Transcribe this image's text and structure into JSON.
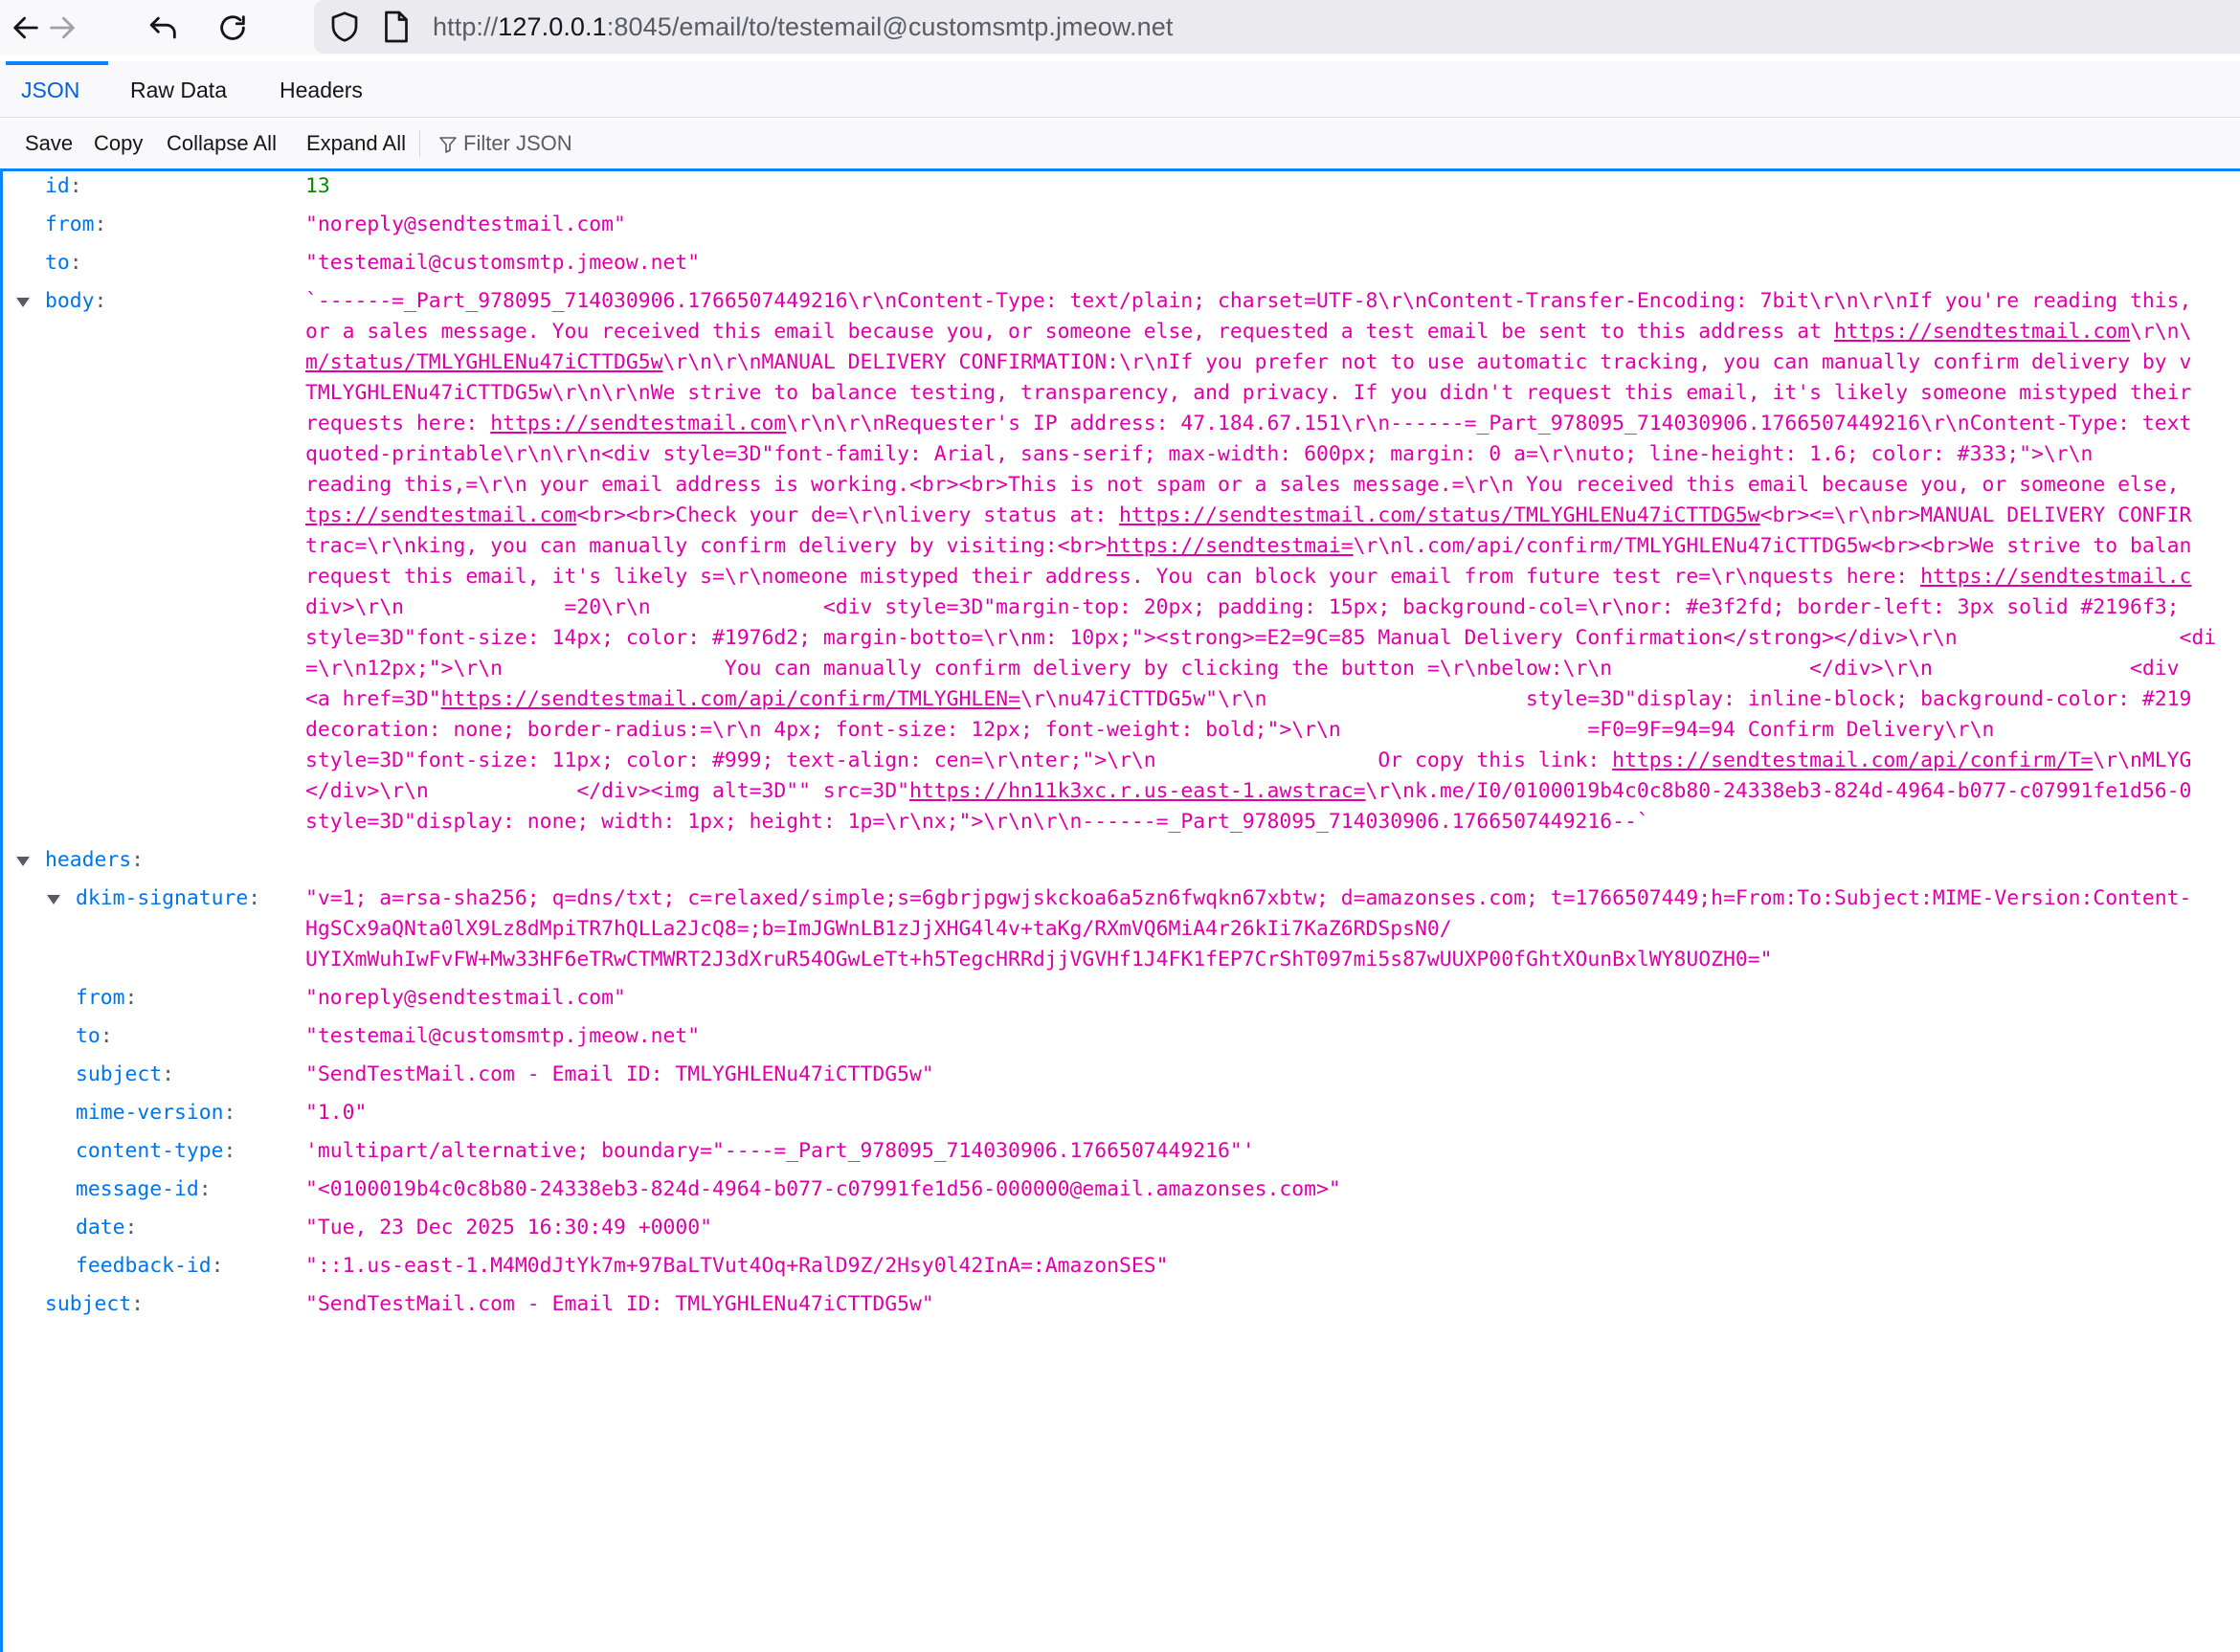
{
  "browser": {
    "url_prefix": "http://",
    "url_host": "127.0.0.1",
    "url_rest": ":8045/email/to/testemail@customsmtp.jmeow.net",
    "back_icon": "arrow-left",
    "forward_icon": "arrow-right",
    "undo_icon": "undo-arrow",
    "reload_icon": "reload"
  },
  "tabs": {
    "json": "JSON",
    "raw": "Raw Data",
    "headers": "Headers"
  },
  "toolbar": {
    "save": "Save",
    "copy": "Copy",
    "collapse": "Collapse All",
    "expand": "Expand All",
    "filter_placeholder": "Filter JSON"
  },
  "json": {
    "id_key": "id",
    "id": "13",
    "from_key": "from",
    "from": "\"noreply@sendtestmail.com\"",
    "to_key": "to",
    "to": "\"testemail@customsmtp.jmeow.net\"",
    "body_key": "body",
    "body_lines": [
      "`------=_Part_978095_714030906.1766507449216\\r\\nContent-Type: text/plain; charset=UTF-8\\r\\nContent-Transfer-Encoding: 7bit\\r\\n\\r\\nIf you're reading this,",
      "or a sales message. You received this email because you, or someone else, requested a test email be sent to this address at https://sendtestmail.com\\r\\n\\",
      "m/status/TMLYGHLENu47iCTTDG5w\\r\\n\\r\\nMANUAL DELIVERY CONFIRMATION:\\r\\nIf you prefer not to use automatic tracking, you can manually confirm delivery by v",
      "TMLYGHLENu47iCTTDG5w\\r\\n\\r\\nWe strive to balance testing, transparency, and privacy. If you didn't request this email, it's likely someone mistyped their",
      "requests here: https://sendtestmail.com\\r\\n\\r\\nRequester's IP address: 47.184.67.151\\r\\n------=_Part_978095_714030906.1766507449216\\r\\nContent-Type: text",
      "quoted-printable\\r\\n\\r\\n<div style=3D\"font-family: Arial, sans-serif; max-width: 600px; margin: 0 a=\\r\\nuto; line-height: 1.6; color: #333;\">\\r\\n",
      "reading this,=\\r\\n your email address is working.<br><br>This is not spam or a sales message.=\\r\\n You received this email because you, or someone else,",
      "tps://sendtestmail.com<br><br>Check your de=\\r\\nlivery status at: https://sendtestmail.com/status/TMLYGHLENu47iCTTDG5w<br><=\\r\\nbr>MANUAL DELIVERY CONFIR",
      "trac=\\r\\nking, you can manually confirm delivery by visiting:<br>https://sendtestmai=\\r\\nl.com/api/confirm/TMLYGHLENu47iCTTDG5w<br><br>We strive to balan",
      "request this email, it's likely s=\\r\\nomeone mistyped their address. You can block your email from future test re=\\r\\nquests here: https://sendtestmail.c",
      "div>\\r\\n             =20\\r\\n              <div style=3D\"margin-top: 20px; padding: 15px; background-col=\\r\\nor: #e3f2fd; border-left: 3px solid #2196f3;",
      "style=3D\"font-size: 14px; color: #1976d2; margin-botto=\\r\\nm: 10px;\"><strong>=E2=9C=85 Manual Delivery Confirmation</strong></div>\\r\\n                  <di",
      "=\\r\\n12px;\">\\r\\n                  You can manually confirm delivery by clicking the button =\\r\\nbelow:\\r\\n                </div>\\r\\n                <div",
      "<a href=3D\"https://sendtestmail.com/api/confirm/TMLYGHLEN=\\r\\nu47iCTTDG5w\"\\r\\n                     style=3D\"display: inline-block; background-color: #219",
      "decoration: none; border-radius:=\\r\\n 4px; font-size: 12px; font-weight: bold;\">\\r\\n                    =F0=9F=94=94 Confirm Delivery\\r\\n",
      "style=3D\"font-size: 11px; color: #999; text-align: cen=\\r\\nter;\">\\r\\n                  Or copy this link: https://sendtestmail.com/api/confirm/T=\\r\\nMLYG",
      "</div>\\r\\n            </div><img alt=3D\"\" src=3D\"https://hn11k3xc.r.us-east-1.awstrac=\\r\\nk.me/I0/0100019b4c0c8b80-24338eb3-824d-4964-b077-c07991fe1d56-0",
      "style=3D\"display: none; width: 1px; height: 1p=\\r\\nx;\">\\r\\n\\r\\n------=_Part_978095_714030906.1766507449216--`"
    ],
    "headers_key": "headers",
    "dkim_key": "dkim-signature",
    "dkim_lines": [
      "\"v=1; a=rsa-sha256; q=dns/txt; c=relaxed/simple;s=6gbrjpgwjskckoa6a5zn6fwqkn67xbtw; d=amazonses.com; t=1766507449;h=From:To:Subject:MIME-Version:Content-",
      "HgSCx9aQNta0lX9Lz8dMpiTR7hQLLa2JcQ8=;b=ImJGWnLB1zJjXHG4l4v+taKg/RXmVQ6MiA4r26kIi7KaZ6RDSpsN0/",
      "UYIXmWuhIwFvFW+Mw33HF6eTRwCTMWRT2J3dXruR54OGwLeTt+h5TegcHRRdjjVGVHf1J4FK1fEP7CrShT097mi5s87wUUXP00fGhtXOunBxlWY8UOZH0=\""
    ],
    "h_from_key": "from",
    "h_from": "\"noreply@sendtestmail.com\"",
    "h_to_key": "to",
    "h_to": "\"testemail@customsmtp.jmeow.net\"",
    "h_subject_key": "subject",
    "h_subject": "\"SendTestMail.com - Email ID: TMLYGHLENu47iCTTDG5w\"",
    "h_mime_key": "mime-version",
    "h_mime": "\"1.0\"",
    "h_ctype_key": "content-type",
    "h_ctype": "'multipart/alternative; boundary=\"----=_Part_978095_714030906.1766507449216\"'",
    "h_msgid_key": "message-id",
    "h_msgid": "\"<0100019b4c0c8b80-24338eb3-824d-4964-b077-c07991fe1d56-000000@email.amazonses.com>\"",
    "h_date_key": "date",
    "h_date": "\"Tue, 23 Dec 2025 16:30:49 +0000\"",
    "h_fid_key": "feedback-id",
    "h_fid": "\"::1.us-east-1.M4M0dJtYk7m+97BaLTVut4Oq+RalD9Z/2Hsy0l42InA=:AmazonSES\"",
    "subject_key": "subject",
    "subject": "\"SendTestMail.com - Email ID: TMLYGHLENu47iCTTDG5w\""
  }
}
